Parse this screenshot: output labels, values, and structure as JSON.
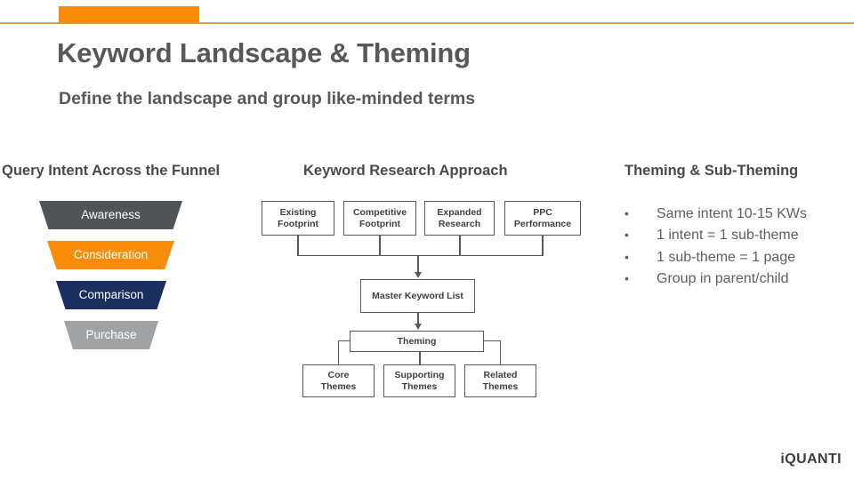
{
  "header": {
    "title": "Keyword Landscape & Theming",
    "subtitle": "Define the landscape and group like-minded terms",
    "accent_color": "#f98c0a",
    "rule_color": "#c8a64b"
  },
  "sections": {
    "funnel_heading": "Query Intent Across the Funnel",
    "flow_heading": "Keyword Research Approach",
    "theming_heading": "Theming & Sub-Theming"
  },
  "funnel": {
    "stages": [
      {
        "label": "Awareness",
        "color": "#515457"
      },
      {
        "label": "Consideration",
        "color": "#f98c0a"
      },
      {
        "label": "Comparison",
        "color": "#1b2f5f"
      },
      {
        "label": "Purchase",
        "color": "#a0a3a6"
      }
    ]
  },
  "flowchart": {
    "inputs": [
      "Existing\nFootprint",
      "Competitive\nFootprint",
      "Expanded\nResearch",
      "PPC\nPerformance"
    ],
    "master": "Master Keyword List",
    "theming": "Theming",
    "theme_types": [
      "Core\nThemes",
      "Supporting\nThemes",
      "Related\nThemes"
    ]
  },
  "theming_bullets": {
    "marker": "•",
    "items": [
      "Same intent 10-15 KWs",
      "1 intent = 1 sub-theme",
      "1 sub-theme = 1 page",
      "Group in parent/child"
    ]
  },
  "footer": {
    "logo": "iQUANTI"
  }
}
